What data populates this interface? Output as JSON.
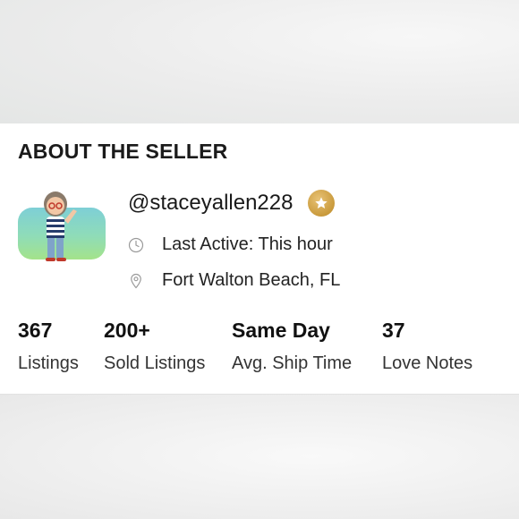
{
  "section": {
    "title": "ABOUT THE SELLER"
  },
  "seller": {
    "username": "@staceyallen228",
    "last_active": "Last Active: This hour",
    "location": "Fort Walton Beach, FL"
  },
  "stats": [
    {
      "value": "367",
      "label": "Listings"
    },
    {
      "value": "200+",
      "label": "Sold Listings"
    },
    {
      "value": "Same Day",
      "label": "Avg. Ship Time"
    },
    {
      "value": "37",
      "label": "Love Notes"
    }
  ],
  "icons": {
    "badge": "star-badge-icon",
    "last_active": "clock-icon",
    "location": "location-pin-icon"
  },
  "colors": {
    "badge_gold": "#c99a3c",
    "icon_gray": "#9a9a9a"
  }
}
